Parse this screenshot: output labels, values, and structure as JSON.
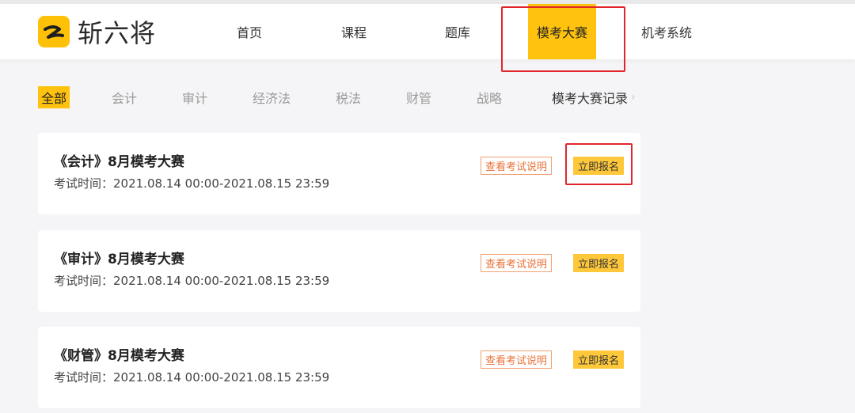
{
  "brand": {
    "name": "斩六将",
    "accent_color": "#ffc20e",
    "highlight_color": "#e0262b"
  },
  "nav": {
    "items": [
      {
        "label": "首页"
      },
      {
        "label": "课程"
      },
      {
        "label": "题库"
      },
      {
        "label": "模考大赛",
        "active": true
      },
      {
        "label": "机考系统"
      }
    ]
  },
  "filters": {
    "items": [
      {
        "label": "全部",
        "active": true
      },
      {
        "label": "会计"
      },
      {
        "label": "审计"
      },
      {
        "label": "经济法"
      },
      {
        "label": "税法"
      },
      {
        "label": "财管"
      },
      {
        "label": "战略"
      }
    ],
    "record_label": "模考大赛记录"
  },
  "contests": [
    {
      "title": "《会计》8月模考大赛",
      "time": "考试时间：2021.08.14 00:00-2021.08.15 23:59",
      "desc_label": "查看考试说明",
      "signup_label": "立即报名"
    },
    {
      "title": "《审计》8月模考大赛",
      "time": "考试时间：2021.08.14 00:00-2021.08.15 23:59",
      "desc_label": "查看考试说明",
      "signup_label": "立即报名"
    },
    {
      "title": "《财管》8月模考大赛",
      "time": "考试时间：2021.08.14 00:00-2021.08.15 23:59",
      "desc_label": "查看考试说明",
      "signup_label": "立即报名"
    }
  ]
}
